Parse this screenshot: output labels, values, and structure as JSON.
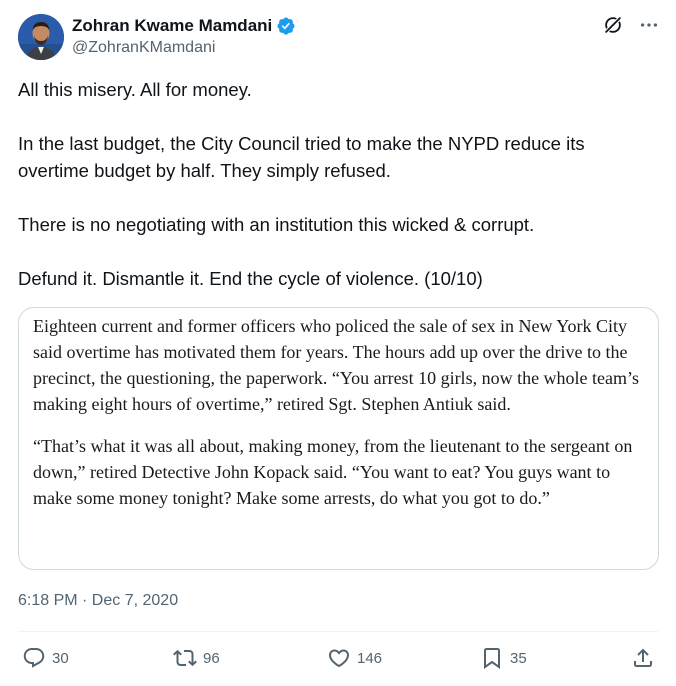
{
  "author": {
    "display_name": "Zohran Kwame Mamdani",
    "handle": "@ZohranKMamdani",
    "verified_icon": "verified-badge-icon",
    "avatar_color": "#2b5cab"
  },
  "tweet": {
    "paragraphs": [
      "All this misery. All for money.",
      "In the last budget, the City Council tried to make the NYPD reduce its overtime budget by half. They simply refused.",
      "There is no negotiating with an institution this wicked & corrupt.",
      "Defund it. Dismantle it. End the cycle of violence. (10/10)"
    ],
    "quote_image": {
      "paragraphs": [
        "Eighteen current and former officers who policed the sale of sex in New York City said overtime has motivated them for years. The hours add up over the drive to the precinct, the questioning, the paperwork. “You arrest 10 girls, now the whole team’s making eight hours of overtime,” retired Sgt. Stephen Antiuk said.",
        "“That’s what it was all about, making money, from the lieutenant to the sergeant on down,” retired Detective John Kopack said. “You want to eat? You guys want to make some money tonight? Make some arrests, do what you got to do.”"
      ]
    },
    "timestamp": "6:18 PM · Dec 7, 2020"
  },
  "actions": {
    "replies": "30",
    "reposts": "96",
    "likes": "146",
    "bookmarks": "35"
  },
  "colors": {
    "text": "#0f1419",
    "secondary": "#536471",
    "verified": "#1d9bf0",
    "border": "#cfd9de"
  }
}
